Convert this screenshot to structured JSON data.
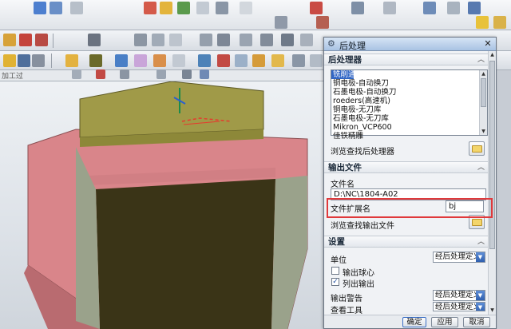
{
  "dialog": {
    "title": "后处理",
    "close_glyph": "✕",
    "section_postprocessor": "后处理器",
    "postprocessors": [
      "铣削通用",
      "铜电极-自动换刀",
      "石墨电极-自动换刀",
      "roeders(高速机)",
      "铜电极-无刀库",
      "石墨电极-无刀库",
      "Mikron_VCP600",
      "佳铁精雕"
    ],
    "browse_postprocessor": "浏览查找后处理器",
    "section_output": "输出文件",
    "filename_label": "文件名",
    "filename_value": "D:\\NC\\1804-A02",
    "extension_label": "文件扩展名",
    "extension_value": "bj",
    "browse_output": "浏览查找输出文件",
    "section_settings": "设置",
    "units_label": "单位",
    "units_value": "经后处理定义",
    "output_ball_center": "输出球心",
    "list_output": "列出输出",
    "output_warning_label": "输出警告",
    "output_warning_value": "经后处理定义",
    "check_tool_label": "查看工具",
    "check_tool_value": "经后处理定义",
    "ok_label": "确定",
    "apply_label": "应用",
    "cancel_label": "取消",
    "highlight_color": "#e0393b"
  },
  "toolbar": {
    "row4_label": "加工过"
  },
  "viewport": {
    "model_colors": {
      "base": "#d9858a",
      "top": "#9a9442",
      "block": "#3a3417",
      "side": "#9aa28b"
    }
  }
}
